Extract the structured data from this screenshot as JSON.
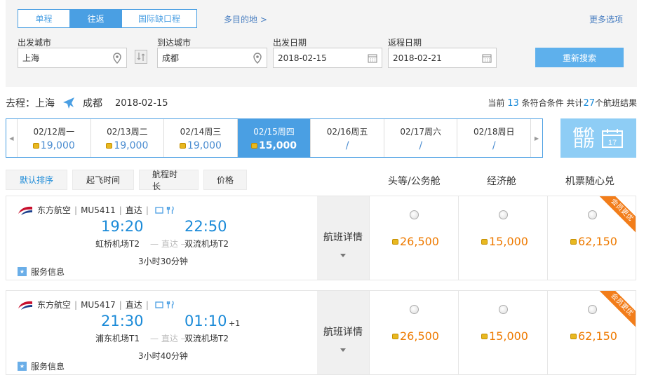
{
  "search": {
    "tabs": [
      "单程",
      "往返",
      "国际缺口程"
    ],
    "multi_city": "多目的地 >",
    "more_options": "更多选项",
    "from_label": "出发城市",
    "from_value": "上海",
    "to_label": "到达城市",
    "to_value": "成都",
    "depart_label": "出发日期",
    "depart_value": "2018-02-15",
    "return_label": "返程日期",
    "return_value": "2018-02-21",
    "search_button": "重新搜索"
  },
  "route": {
    "prefix": "去程：上海",
    "to": "成都",
    "date": "2018-02-15"
  },
  "results": {
    "pre": "当前",
    "matching": "13",
    "mid": "条符合条件 共计",
    "total": "27",
    "post": "个航班结果"
  },
  "dates": [
    {
      "date": "02/12周一",
      "price": "19,000",
      "coin": true
    },
    {
      "date": "02/13周二",
      "price": "19,000",
      "coin": true
    },
    {
      "date": "02/14周三",
      "price": "19,000",
      "coin": true
    },
    {
      "date": "02/15周四",
      "price": "15,000",
      "coin": true,
      "active": true
    },
    {
      "date": "02/16周五",
      "price": "/",
      "coin": false
    },
    {
      "date": "02/17周六",
      "price": "/",
      "coin": false
    },
    {
      "date": "02/18周日",
      "price": "/",
      "coin": false
    }
  ],
  "calendar_button": {
    "label": "低价日历",
    "day": "17"
  },
  "sort": {
    "buttons": [
      "默认排序",
      "起飞时间",
      "航程时长",
      "价格"
    ]
  },
  "cabin_headers": [
    "头等/公务舱",
    "经济舱",
    "机票随心兑"
  ],
  "flights": [
    {
      "airline": "东方航空",
      "flight_no": "MU5411",
      "type": "直达",
      "dep_time": "19:20",
      "arr_time": "22:50",
      "dep_airport": "虹桥机场T2",
      "direct_text": "— 直达 —",
      "arr_airport": "双流机场T2",
      "plus_day": "",
      "duration": "3小时30分钟",
      "service": "服务信息",
      "details": "航班详情",
      "prices": [
        "26,500",
        "15,000",
        "62,150"
      ],
      "ribbon": "会员更优"
    },
    {
      "airline": "东方航空",
      "flight_no": "MU5417",
      "type": "直达",
      "dep_time": "21:30",
      "arr_time": "01:10",
      "dep_airport": "浦东机场T1",
      "direct_text": "— 直达 —",
      "arr_airport": "双流机场T2",
      "plus_day": "+1",
      "duration": "3小时40分钟",
      "service": "服务信息",
      "details": "航班详情",
      "prices": [
        "26,500",
        "15,000",
        "62,150"
      ],
      "ribbon": "会员更优"
    }
  ],
  "colors": {
    "accent": "#4a9fe3",
    "price": "#ee7a00",
    "time": "#1a8ad8",
    "ribbon": "#f27d1a"
  }
}
